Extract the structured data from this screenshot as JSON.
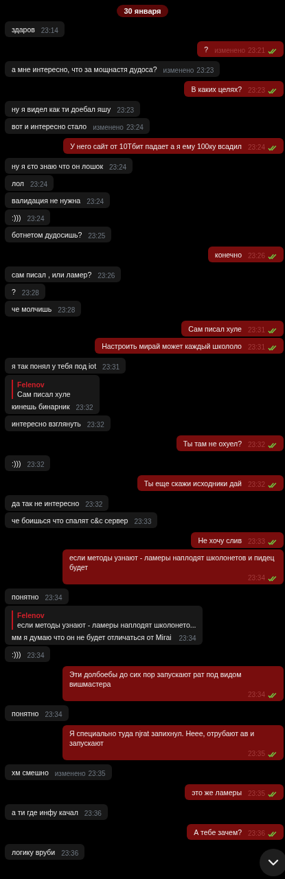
{
  "date_badge": "30 января",
  "messages": [
    {
      "kind": "in",
      "text": "здаров",
      "time": "23:14"
    },
    {
      "kind": "out",
      "text": "?",
      "edited": "изменено",
      "time": "23:21",
      "read": true
    },
    {
      "kind": "in",
      "text": "а мне интересно, что за мощнастя дудоса?",
      "edited": "изменено",
      "time": "23:23"
    },
    {
      "kind": "out",
      "text": "В каких целях?",
      "time": "23:23",
      "read": true
    },
    {
      "kind": "in",
      "text": "ну я видел как ти доебал яшу",
      "time": "23:23"
    },
    {
      "kind": "in",
      "text": "вот и интересно стало",
      "edited": "изменено",
      "time": "23:24"
    },
    {
      "kind": "out",
      "text": "У него сайт от 10Тбит падает а я ему 100ку всадил",
      "time": "23:24",
      "read": true
    },
    {
      "kind": "in",
      "text": "ну я єто знаю что он лошок",
      "time": "23:24"
    },
    {
      "kind": "in",
      "text": "лол",
      "time": "23:24"
    },
    {
      "kind": "in",
      "text": "валидация не нужна",
      "time": "23:24"
    },
    {
      "kind": "in",
      "text": ":)))",
      "time": "23:24"
    },
    {
      "kind": "in",
      "text": "ботнетом дудосишь?",
      "time": "23:25"
    },
    {
      "kind": "out",
      "text": "конечно",
      "time": "23:26",
      "read": true
    },
    {
      "kind": "in",
      "text": "сам писал , или ламер?",
      "time": "23:26"
    },
    {
      "kind": "in",
      "text": "?",
      "time": "23:28"
    },
    {
      "kind": "in",
      "text": "че молчишь",
      "time": "23:28"
    },
    {
      "kind": "out",
      "text": "Сам писал хуле",
      "time": "23:31",
      "read": true
    },
    {
      "kind": "out",
      "text": "Настроить мирай может каждый школоло",
      "time": "23:31",
      "read": true
    },
    {
      "kind": "in",
      "text": "я так понял у тебя под iot",
      "time": "23:31"
    },
    {
      "kind": "in",
      "reply": {
        "author": "Felenov",
        "text": "Сам писал хуле"
      },
      "text": "кинешь бинарник",
      "time": "23:32"
    },
    {
      "kind": "in",
      "text": "интересно взглянуть",
      "time": "23:32"
    },
    {
      "kind": "out",
      "text": "Ты там не охуел?",
      "time": "23:32",
      "read": true
    },
    {
      "kind": "in",
      "text": ":)))",
      "time": "23:32"
    },
    {
      "kind": "out",
      "text": "Ты еще скажи исходники дай",
      "time": "23:32",
      "read": true
    },
    {
      "kind": "in",
      "text": "да так не интересно",
      "time": "23:32"
    },
    {
      "kind": "in",
      "text": "че боишься что спалят c&c сервер",
      "time": "23:33"
    },
    {
      "kind": "out",
      "text": "Не хочу слив",
      "time": "23:33",
      "read": true
    },
    {
      "kind": "out",
      "text": "если методы узнают - ламеры наплодят школонетов и пидец будет",
      "time": "23:34",
      "read": true
    },
    {
      "kind": "in",
      "text": "понятно",
      "time": "23:34"
    },
    {
      "kind": "in",
      "reply": {
        "author": "Felenov",
        "text": "если методы узнают - ламеры наплодят школонето..."
      },
      "text": "мм я думаю что он не будет отличаться от Mirai",
      "time": "23:34"
    },
    {
      "kind": "in",
      "text": ":)))",
      "time": "23:34"
    },
    {
      "kind": "out",
      "text": "Эти долбоебы до сих пор запускают рат под видом вишмастера",
      "time": "23:34",
      "read": true
    },
    {
      "kind": "in",
      "text": "понятно",
      "time": "23:34"
    },
    {
      "kind": "out",
      "text": "Я специально туда njrat запихнул. Неее, отрубают ав и запускают",
      "time": "23:35",
      "read": true
    },
    {
      "kind": "in",
      "text": "хм смешно",
      "edited": "изменено",
      "time": "23:35"
    },
    {
      "kind": "out",
      "text": "это же ламеры",
      "time": "23:35",
      "read": true
    },
    {
      "kind": "in",
      "text": "а ти где инфу качал",
      "time": "23:36"
    },
    {
      "kind": "out",
      "text": "А тебе зачем?",
      "time": "23:36",
      "read": true
    },
    {
      "kind": "in",
      "text": "логику вруби",
      "time": "23:36"
    }
  ]
}
